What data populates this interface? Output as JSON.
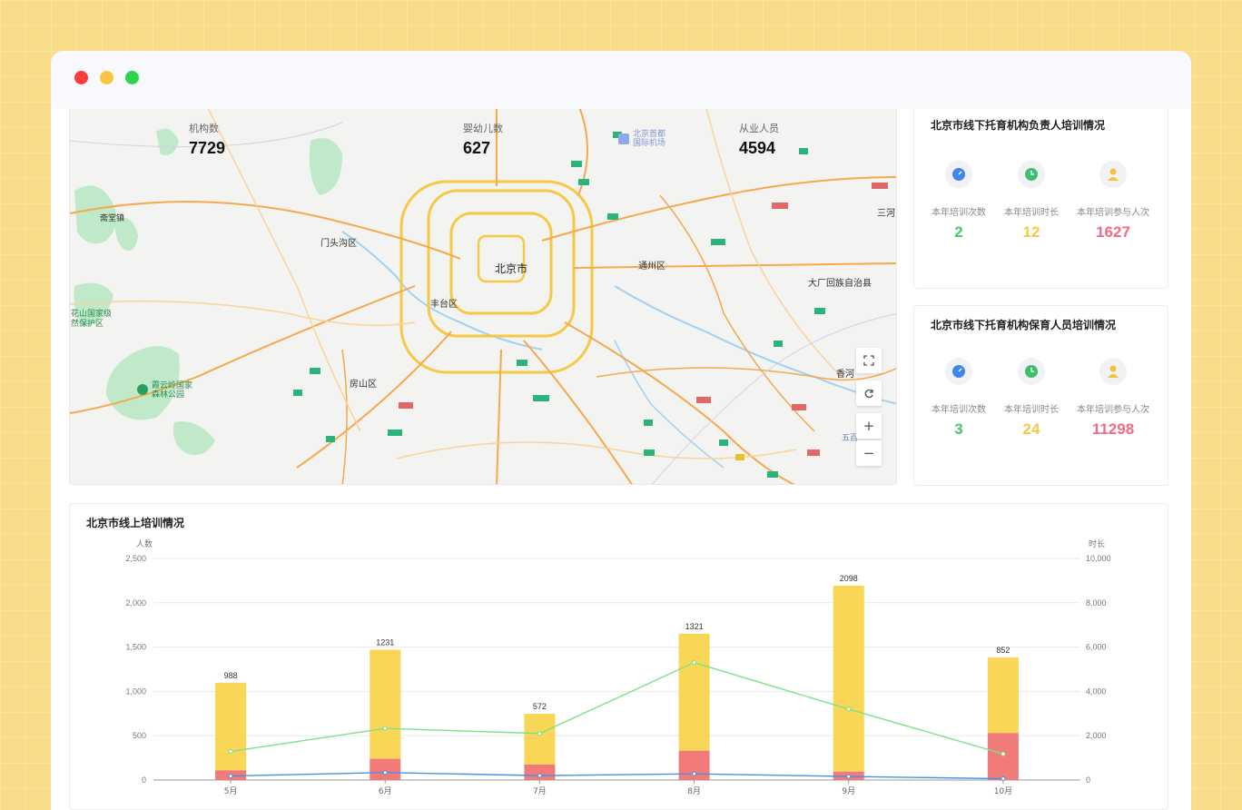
{
  "window": {
    "controls": [
      "close",
      "minimize",
      "maximize"
    ]
  },
  "map": {
    "stats": [
      {
        "label": "机构数",
        "value": "7729"
      },
      {
        "label": "婴幼儿数",
        "value": "627"
      },
      {
        "label": "从业人员",
        "value": "4594"
      }
    ],
    "places": {
      "beijing": "北京市",
      "mentougou": "门头沟区",
      "fengtai": "丰台区",
      "fangshan": "房山区",
      "tongzhou": "通州区",
      "dachang": "大厂回族自治县",
      "sanhe": "三河",
      "xianghe": "香河",
      "airport": "北京首都\n国际机场",
      "zhaitang": "斋堂镇",
      "baihua": "花山国家级\n然保护区",
      "xiayunling": "霞云岭国家\n森林公园",
      "wubai": "五百"
    },
    "controls": {
      "fullscreen_icon": "fullscreen-icon",
      "refresh_icon": "refresh-icon",
      "zoom_in": "+",
      "zoom_out": "−"
    }
  },
  "cards": [
    {
      "title": "北京市线下托育机构负责人培训情况",
      "kpis": [
        {
          "icon": "gauge-icon",
          "label": "本年培训次数",
          "value": "2",
          "color": "#4cc66b"
        },
        {
          "icon": "clock-icon",
          "label": "本年培训时长",
          "value": "12",
          "color": "#f6c945"
        },
        {
          "icon": "user-icon",
          "label": "本年培训参与人次",
          "value": "1627",
          "color": "#f26b83"
        }
      ]
    },
    {
      "title": "北京市线下托育机构保育人员培训情况",
      "kpis": [
        {
          "icon": "gauge-icon",
          "label": "本年培训次数",
          "value": "3",
          "color": "#4cc66b"
        },
        {
          "icon": "clock-icon",
          "label": "本年培训时长",
          "value": "24",
          "color": "#f6c945"
        },
        {
          "icon": "user-icon",
          "label": "本年培训参与人次",
          "value": "11298",
          "color": "#f26b83"
        }
      ]
    }
  ],
  "chart_data": {
    "type": "bar",
    "title": "北京市线上培训情况",
    "ylabel": "人数",
    "y2label": "时长",
    "categories": [
      "5月",
      "6月",
      "7月",
      "8月",
      "9月",
      "10月"
    ],
    "ylim": [
      0,
      2500
    ],
    "y2lim": [
      0,
      10000
    ],
    "yticks": [
      "0",
      "500",
      "1,000",
      "1,500",
      "2,000",
      "2,500"
    ],
    "y2ticks": [
      "0",
      "2,000",
      "4,000",
      "6,000",
      "8,000",
      "10,000"
    ],
    "series": [
      {
        "type": "stacked-bar",
        "color": "#f27a79",
        "values": [
          110,
          240,
          175,
          330,
          95,
          530
        ]
      },
      {
        "type": "stacked-bar",
        "color": "#f9d655",
        "values": [
          988,
          1231,
          572,
          1321,
          2098,
          852
        ]
      },
      {
        "type": "line-right-axis",
        "color": "#7fe08a",
        "values": [
          1290,
          2330,
          2100,
          5300,
          3200,
          1180
        ]
      },
      {
        "type": "line-left-axis",
        "color": "#4a90e2",
        "values": [
          45,
          85,
          50,
          70,
          40,
          15
        ]
      }
    ],
    "bar_labels": [
      "988",
      "1231",
      "572",
      "1321",
      "2098",
      "852"
    ],
    "grid": true
  }
}
